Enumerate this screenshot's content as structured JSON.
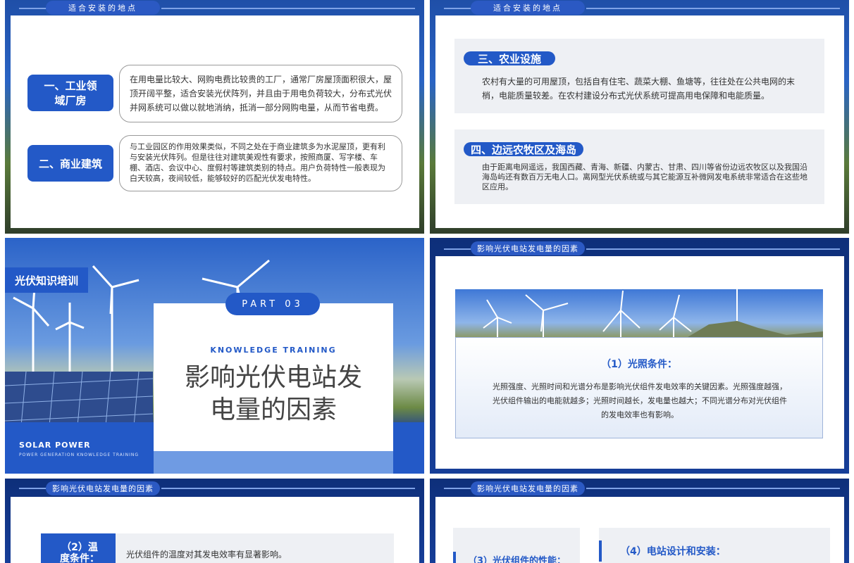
{
  "slide1": {
    "header": "适合安装的地点",
    "item1_title": "一、工业领域厂房",
    "item1_text": "在用电量比较大、网购电费比较贵的工厂，通常厂房屋顶面积很大，屋顶开阔平整，适合安装光伏阵列，并且由于用电负荷较大，分布式光伏并网系统可以做以就地消纳，抵消一部分网购电量，从而节省电费。",
    "item2_title": "二、商业建筑",
    "item2_text": "与工业园区的作用效果类似，不同之处在于商业建筑多为水泥屋顶，更有利与安装光伏阵列。但是往往对建筑美观性有要求，按照商厦、写字楼、车棚、酒店、会议中心、度假村等建筑类别的特点。用户负荷特性一般表现为白天较高，夜间较低，能够较好的匹配光伏发电特性。"
  },
  "slide2": {
    "header": "适合安装的地点",
    "item3_title": "三、农业设施",
    "item3_text": "农村有大量的可用屋顶，包括自有住宅、蔬菜大棚、鱼塘等，往往处在公共电网的末梢，电能质量较差。在农村建设分布式光伏系统可提高用电保障和电能质量。",
    "item4_title": "四、边远农牧区及海岛",
    "item4_text": "由于距离电网遥远，我国西藏、青海、新疆、内蒙古、甘肃、四川等省份边远农牧区以及我国沿海岛屿还有数百万无电人口。离网型光伏系统或与其它能源互补微网发电系统非常适合在这些地区应用。"
  },
  "slide3": {
    "badge": "光伏知识培训",
    "part": "PART 03",
    "subtitle": "KNOWLEDGE TRAINING",
    "title_line1": "影响光伏电站发",
    "title_line2": "电量的因素",
    "solar": "SOLAR POWER",
    "solar_sub": "POWER GENERATION KNOWLEDGE TRAINING"
  },
  "slide4": {
    "header": "影响光伏电站发电量的因素",
    "title": "（1）光照条件：",
    "text": "光照强度、光照时间和光谱分布是影响光伏组件发电效率的关键因素。光照强度越强，光伏组件输出的电能就越多；光照时间越长，发电量也越大；不同光谱分布对光伏组件的发电效率也有影响。"
  },
  "slide5": {
    "header": "影响光伏电站发电量的因素",
    "box_title": "（2）温度条件：",
    "text": "光伏组件的温度对其发电效率有显著影响。"
  },
  "slide6": {
    "header": "影响光伏电站发电量的因素",
    "title3": "（3）光伏组件的性能：",
    "title4": "（4）电站设计和安装："
  },
  "colors": {
    "primary": "#2359c7",
    "navy": "#0e2f7a"
  }
}
